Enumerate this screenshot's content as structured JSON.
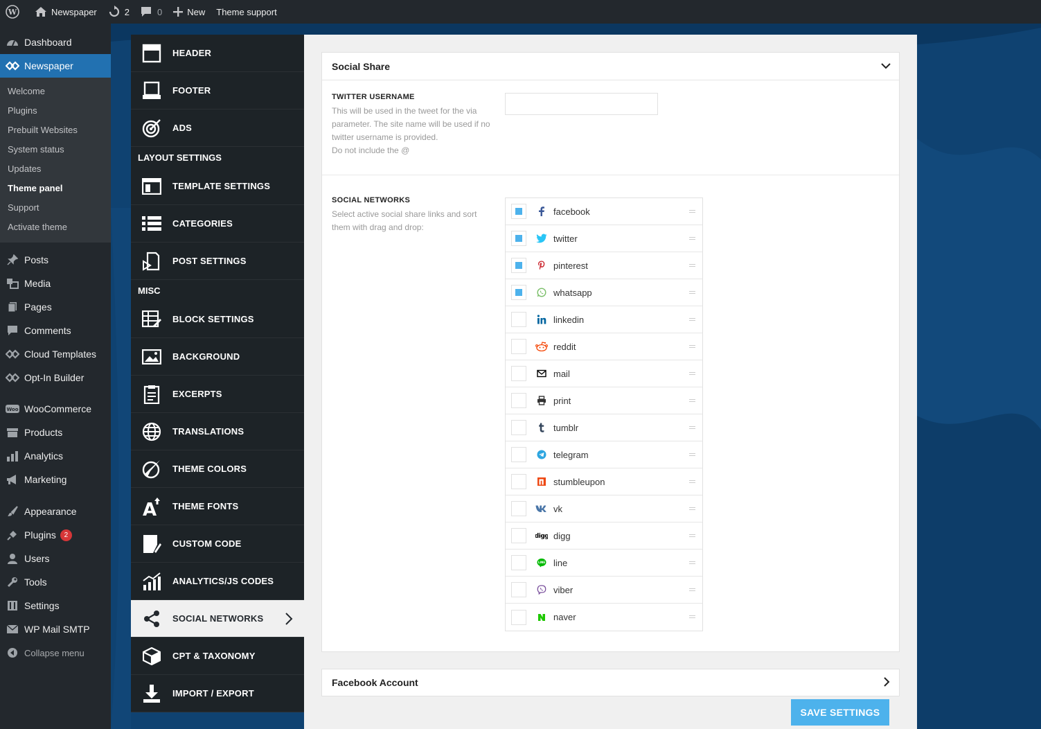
{
  "adminbar": {
    "site_name": "Newspaper",
    "updates_count": "2",
    "comments_count": "0",
    "new_label": "New",
    "theme_support": "Theme support"
  },
  "wpmenu": {
    "dashboard": "Dashboard",
    "newspaper": "Newspaper",
    "submenu": [
      "Welcome",
      "Plugins",
      "Prebuilt Websites",
      "System status",
      "Updates",
      "Theme panel",
      "Support",
      "Activate theme"
    ],
    "group1": [
      "Posts",
      "Media",
      "Pages",
      "Comments",
      "Cloud Templates",
      "Opt-In Builder"
    ],
    "group2": [
      "WooCommerce",
      "Products",
      "Analytics",
      "Marketing"
    ],
    "group3": [
      "Appearance",
      "Plugins",
      "Users",
      "Tools",
      "Settings",
      "WP Mail SMTP"
    ],
    "plugins_badge": "2",
    "collapse": "Collapse menu"
  },
  "tdnav": {
    "header": "HEADER",
    "footer": "FOOTER",
    "ads": "ADS",
    "layout_section": "LAYOUT SETTINGS",
    "template_settings": "TEMPLATE SETTINGS",
    "categories": "CATEGORIES",
    "post_settings": "POST SETTINGS",
    "misc_section": "MISC",
    "block_settings": "BLOCK SETTINGS",
    "background": "BACKGROUND",
    "excerpts": "EXCERPTS",
    "translations": "TRANSLATIONS",
    "theme_colors": "THEME COLORS",
    "theme_fonts": "THEME FONTS",
    "custom_code": "CUSTOM CODE",
    "analytics": "ANALYTICS/JS CODES",
    "social_networks": "SOCIAL NETWORKS",
    "cpt": "CPT & TAXONOMY",
    "import_export": "IMPORT / EXPORT"
  },
  "social_share": {
    "title": "Social Share",
    "twitter_title": "TWITTER USERNAME",
    "twitter_desc": "This will be used in the tweet for the via parameter. The site name will be used if no twitter username is provided.",
    "twitter_desc2": "Do not include the @",
    "twitter_value": "",
    "networks_title": "SOCIAL NETWORKS",
    "networks_desc": "Select active social share links and sort them with drag and drop:",
    "networks": [
      {
        "name": "facebook",
        "checked": true
      },
      {
        "name": "twitter",
        "checked": true
      },
      {
        "name": "pinterest",
        "checked": true
      },
      {
        "name": "whatsapp",
        "checked": true
      },
      {
        "name": "linkedin",
        "checked": false
      },
      {
        "name": "reddit",
        "checked": false
      },
      {
        "name": "mail",
        "checked": false
      },
      {
        "name": "print",
        "checked": false
      },
      {
        "name": "tumblr",
        "checked": false
      },
      {
        "name": "telegram",
        "checked": false
      },
      {
        "name": "stumbleupon",
        "checked": false
      },
      {
        "name": "vk",
        "checked": false
      },
      {
        "name": "digg",
        "checked": false
      },
      {
        "name": "line",
        "checked": false
      },
      {
        "name": "viber",
        "checked": false
      },
      {
        "name": "naver",
        "checked": false
      }
    ]
  },
  "facebook_account": {
    "title": "Facebook Account"
  },
  "save_label": "SAVE SETTINGS",
  "colors": {
    "accent": "#4db2ec",
    "wp_blue": "#2271b1",
    "menu_bg": "#23282d"
  }
}
